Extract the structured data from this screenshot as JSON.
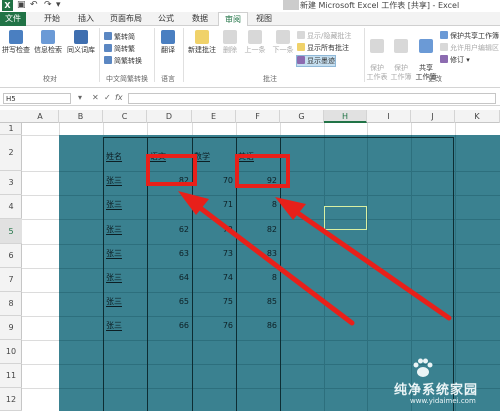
{
  "titlebar": {
    "app_icon": "X",
    "save_icon": "save-icon",
    "undo_icon": "undo-icon",
    "redo_icon": "redo-icon",
    "title": "新建 Microsoft Excel 工作表 [共享] - Excel"
  },
  "tabs": [
    "文件",
    "开始",
    "插入",
    "页面布局",
    "公式",
    "数据",
    "审阅",
    "视图"
  ],
  "active_tab": "审阅",
  "ribbon": {
    "proofing": {
      "label": "校对",
      "spelling": "拼写检查",
      "research": "信息检索",
      "thesaurus": "同义词库"
    },
    "chinese": {
      "label": "中文简繁转换",
      "to_simplified": "繁转简",
      "to_traditional": "简转繁",
      "convert": "简繁转换"
    },
    "language": {
      "label": "语言",
      "translate": "翻译"
    },
    "comments": {
      "label": "批注",
      "new_comment": "新建批注",
      "delete": "删除",
      "prev": "上一条",
      "next": "下一条",
      "show_hide": "显示/隐藏批注",
      "show_all": "显示所有批注",
      "show_ink": "显示墨迹"
    },
    "changes": {
      "label": "更改",
      "protect_sheet": "保护\n工作表",
      "protect_book": "保护\n工作簿",
      "share_book": "共享\n工作簿",
      "protect_share": "保护共享工作簿",
      "allow_edit": "允许用户编辑区",
      "track": "修订"
    }
  },
  "formula_bar": {
    "name_box": "H5",
    "cancel": "✕",
    "enter": "✓",
    "fx": "fx",
    "value": ""
  },
  "columns": [
    "A",
    "B",
    "C",
    "D",
    "E",
    "F",
    "G",
    "H",
    "I",
    "J",
    "K"
  ],
  "selected_column": "H",
  "rows": [
    "1",
    "2",
    "3",
    "4",
    "5",
    "6",
    "7",
    "8",
    "9",
    "10",
    "11",
    "12"
  ],
  "selected_row": "5",
  "table": {
    "headers": [
      "姓名",
      "语文",
      "数学",
      "英语"
    ],
    "rows": [
      {
        "name": "张三",
        "chinese": "82",
        "math": "70",
        "english": "92"
      },
      {
        "name": "张三",
        "chinese": "",
        "math": "71",
        "english": "8"
      },
      {
        "name": "张三",
        "chinese": "62",
        "math": "72",
        "english": "82"
      },
      {
        "name": "张三",
        "chinese": "63",
        "math": "73",
        "english": "83"
      },
      {
        "name": "张三",
        "chinese": "64",
        "math": "74",
        "english": "8"
      },
      {
        "name": "张三",
        "chinese": "65",
        "math": "75",
        "english": "85"
      },
      {
        "name": "张三",
        "chinese": "66",
        "math": "76",
        "english": "86"
      }
    ]
  },
  "colors": {
    "excel_green": "#217346",
    "sheet_fill": "#3a8190",
    "annotation_red": "#e8201a"
  },
  "watermark": {
    "title": "纯净系统家园",
    "url": "www.yidaimei.com"
  }
}
